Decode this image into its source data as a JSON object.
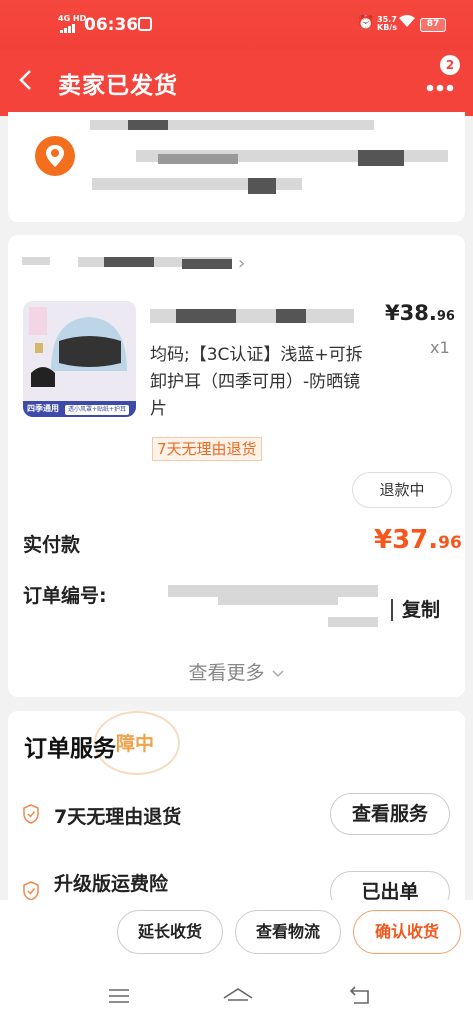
{
  "status_bar": {
    "network": "4G HD",
    "time": "06:36",
    "speed_top": "35.7",
    "speed_unit": "KB/s",
    "battery": "87"
  },
  "navbar": {
    "title": "卖家已发货",
    "badge_count": "2"
  },
  "order": {
    "product_desc": "均码;【3C认证】浅蓝+可拆卸护耳（四季可用）-防晒镜片",
    "price_main": "¥38.",
    "price_decimal": "96",
    "quantity": "x1",
    "image_band_text": "四季通用",
    "image_band_tag": "透小风罩+贴纸+护耳",
    "return_tag": "7天无理由退货",
    "refund_button": "退款中",
    "paid_label": "实付款",
    "paid_main": "¥37.",
    "paid_decimal": "96",
    "order_no_label": "订单编号:",
    "copy_label": "复制",
    "see_more": "查看更多"
  },
  "service": {
    "title": "订单服务",
    "stamp_text": "障中",
    "rows": [
      {
        "label": "7天无理由退货",
        "button": "查看服务"
      },
      {
        "label": "升级版运费险",
        "button": "已出单"
      }
    ]
  },
  "bottom_bar": {
    "extend": "延长收货",
    "logistics": "查看物流",
    "confirm": "确认收货"
  },
  "colors": {
    "brand_red": "#f4433b",
    "accent_orange": "#f5571c"
  }
}
